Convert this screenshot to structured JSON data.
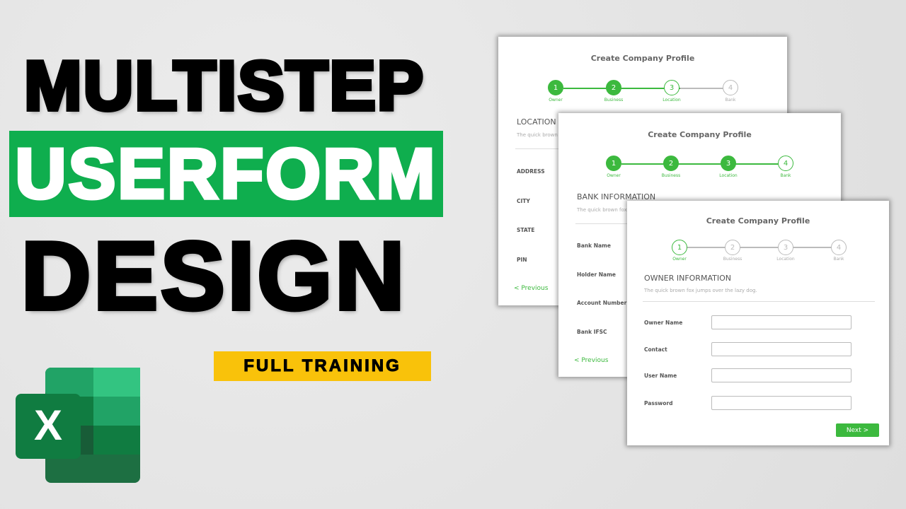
{
  "headline": {
    "line1": "MULTISTEP",
    "line2": "USERFORM",
    "line3": "DESIGN",
    "badge": "FULL TRAINING"
  },
  "logo": {
    "letter": "X",
    "name": "excel-logo"
  },
  "colors": {
    "green": "#0fae4e",
    "step_green": "#3cb93e",
    "yellow": "#f9c20a"
  },
  "steps": [
    "Owner",
    "Business",
    "Location",
    "Bank"
  ],
  "step_numbers": [
    "1",
    "2",
    "3",
    "4"
  ],
  "form_location": {
    "title": "Create Company Profile",
    "current_step": 3,
    "section": "LOCATION",
    "subtitle": "The quick brown fox jumps over the lazy dog.",
    "fields": [
      "ADDRESS",
      "CITY",
      "STATE",
      "PIN"
    ],
    "previous": "<  Previous"
  },
  "form_bank": {
    "title": "Create Company Profile",
    "current_step": 4,
    "section": "BANK INFORMATION",
    "subtitle": "The quick brown fox jumps over the lazy dog.",
    "fields": [
      "Bank Name",
      "Holder Name",
      "Account Number",
      "Bank IFSC"
    ],
    "previous": "<  Previous"
  },
  "form_owner": {
    "title": "Create Company Profile",
    "current_step": 1,
    "section": "OWNER INFORMATION",
    "subtitle": "The quick brown fox jumps over the lazy dog.",
    "fields": [
      "Owner Name",
      "Contact",
      "User Name",
      "Password"
    ],
    "next": "Next  >"
  }
}
